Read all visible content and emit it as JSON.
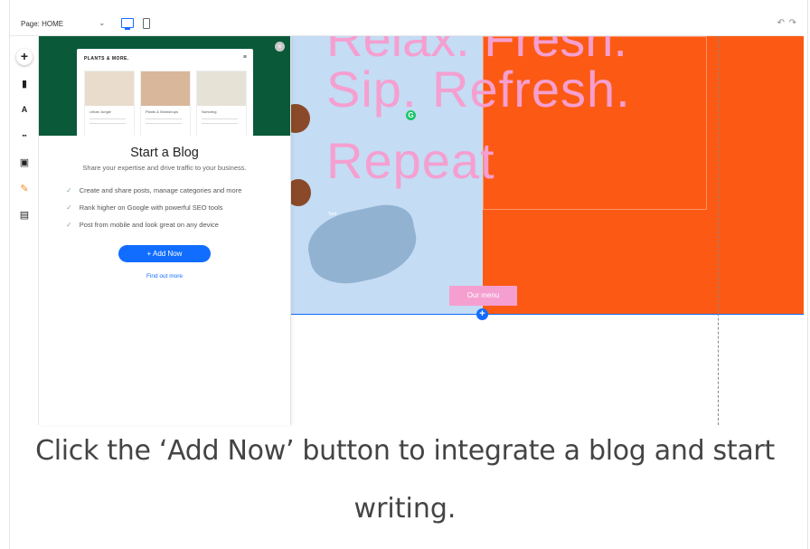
{
  "editor": {
    "page_selector": "Page: HOME",
    "chevron": "⌄",
    "undo": "↶",
    "redo": "↷",
    "accent_color": "#116dff"
  },
  "left_toolbar": {
    "add": "+",
    "pages": "▮",
    "design": "A",
    "apps": "▪▪",
    "media": "▣",
    "blog": "✎",
    "business": "▤"
  },
  "blog_panel": {
    "close": "×",
    "mock_brand": "PLANTS & MORE.",
    "mock_menu": "≡",
    "mock_posts": [
      "Urban Jungle",
      "Plants & Workshops",
      "Nurturing"
    ],
    "title": "Start a Blog",
    "subtitle": "Share your expertise and drive traffic to your business.",
    "features": [
      "Create and share posts, manage categories and more",
      "Rank higher on Google with powerful SEO tools",
      "Post from mobile and look great on any device"
    ],
    "check": "✓",
    "add_now_label": "+ Add Now",
    "find_out_more": "Find out more"
  },
  "site": {
    "hero_partial": "Relax. Fresh.",
    "hero_line1": "Sip. Refresh.",
    "hero_line2": "Repeat",
    "cursor_badge": "G",
    "tiny_text": "Text",
    "cta_label": "Our menu",
    "add_section": "+",
    "colors": {
      "blue": "#c4dcf4",
      "orange": "#fc5a14",
      "pink": "#f59fd0"
    }
  },
  "caption": {
    "line1": "Click the ‘Add Now’ button to integrate a blog and start",
    "line2": "writing."
  }
}
